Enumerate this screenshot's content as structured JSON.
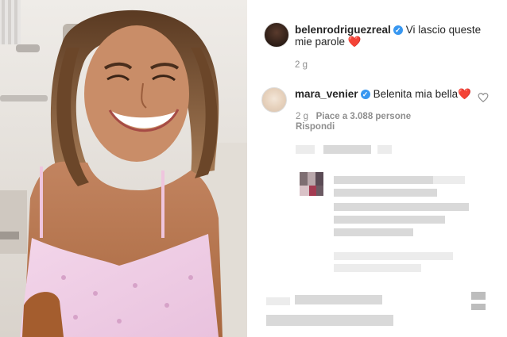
{
  "post": {
    "author": "belenrodriguezreal",
    "caption": "Vi lascio queste",
    "caption_line2": "mie parole",
    "heart": "❤️",
    "time": "2 g"
  },
  "comment": {
    "author": "mara_venier",
    "text": "Belenita mia bella",
    "heart": "❤️",
    "time": "2 g",
    "likes": "Piace a 3.088 persone",
    "reply": "Rispondi"
  },
  "icons": {
    "verified": "verified-badge-icon",
    "like": "heart-outline-icon"
  },
  "colors": {
    "verified": "#3897f0",
    "heart": "#e0242c",
    "meta": "#8e8e8e"
  }
}
